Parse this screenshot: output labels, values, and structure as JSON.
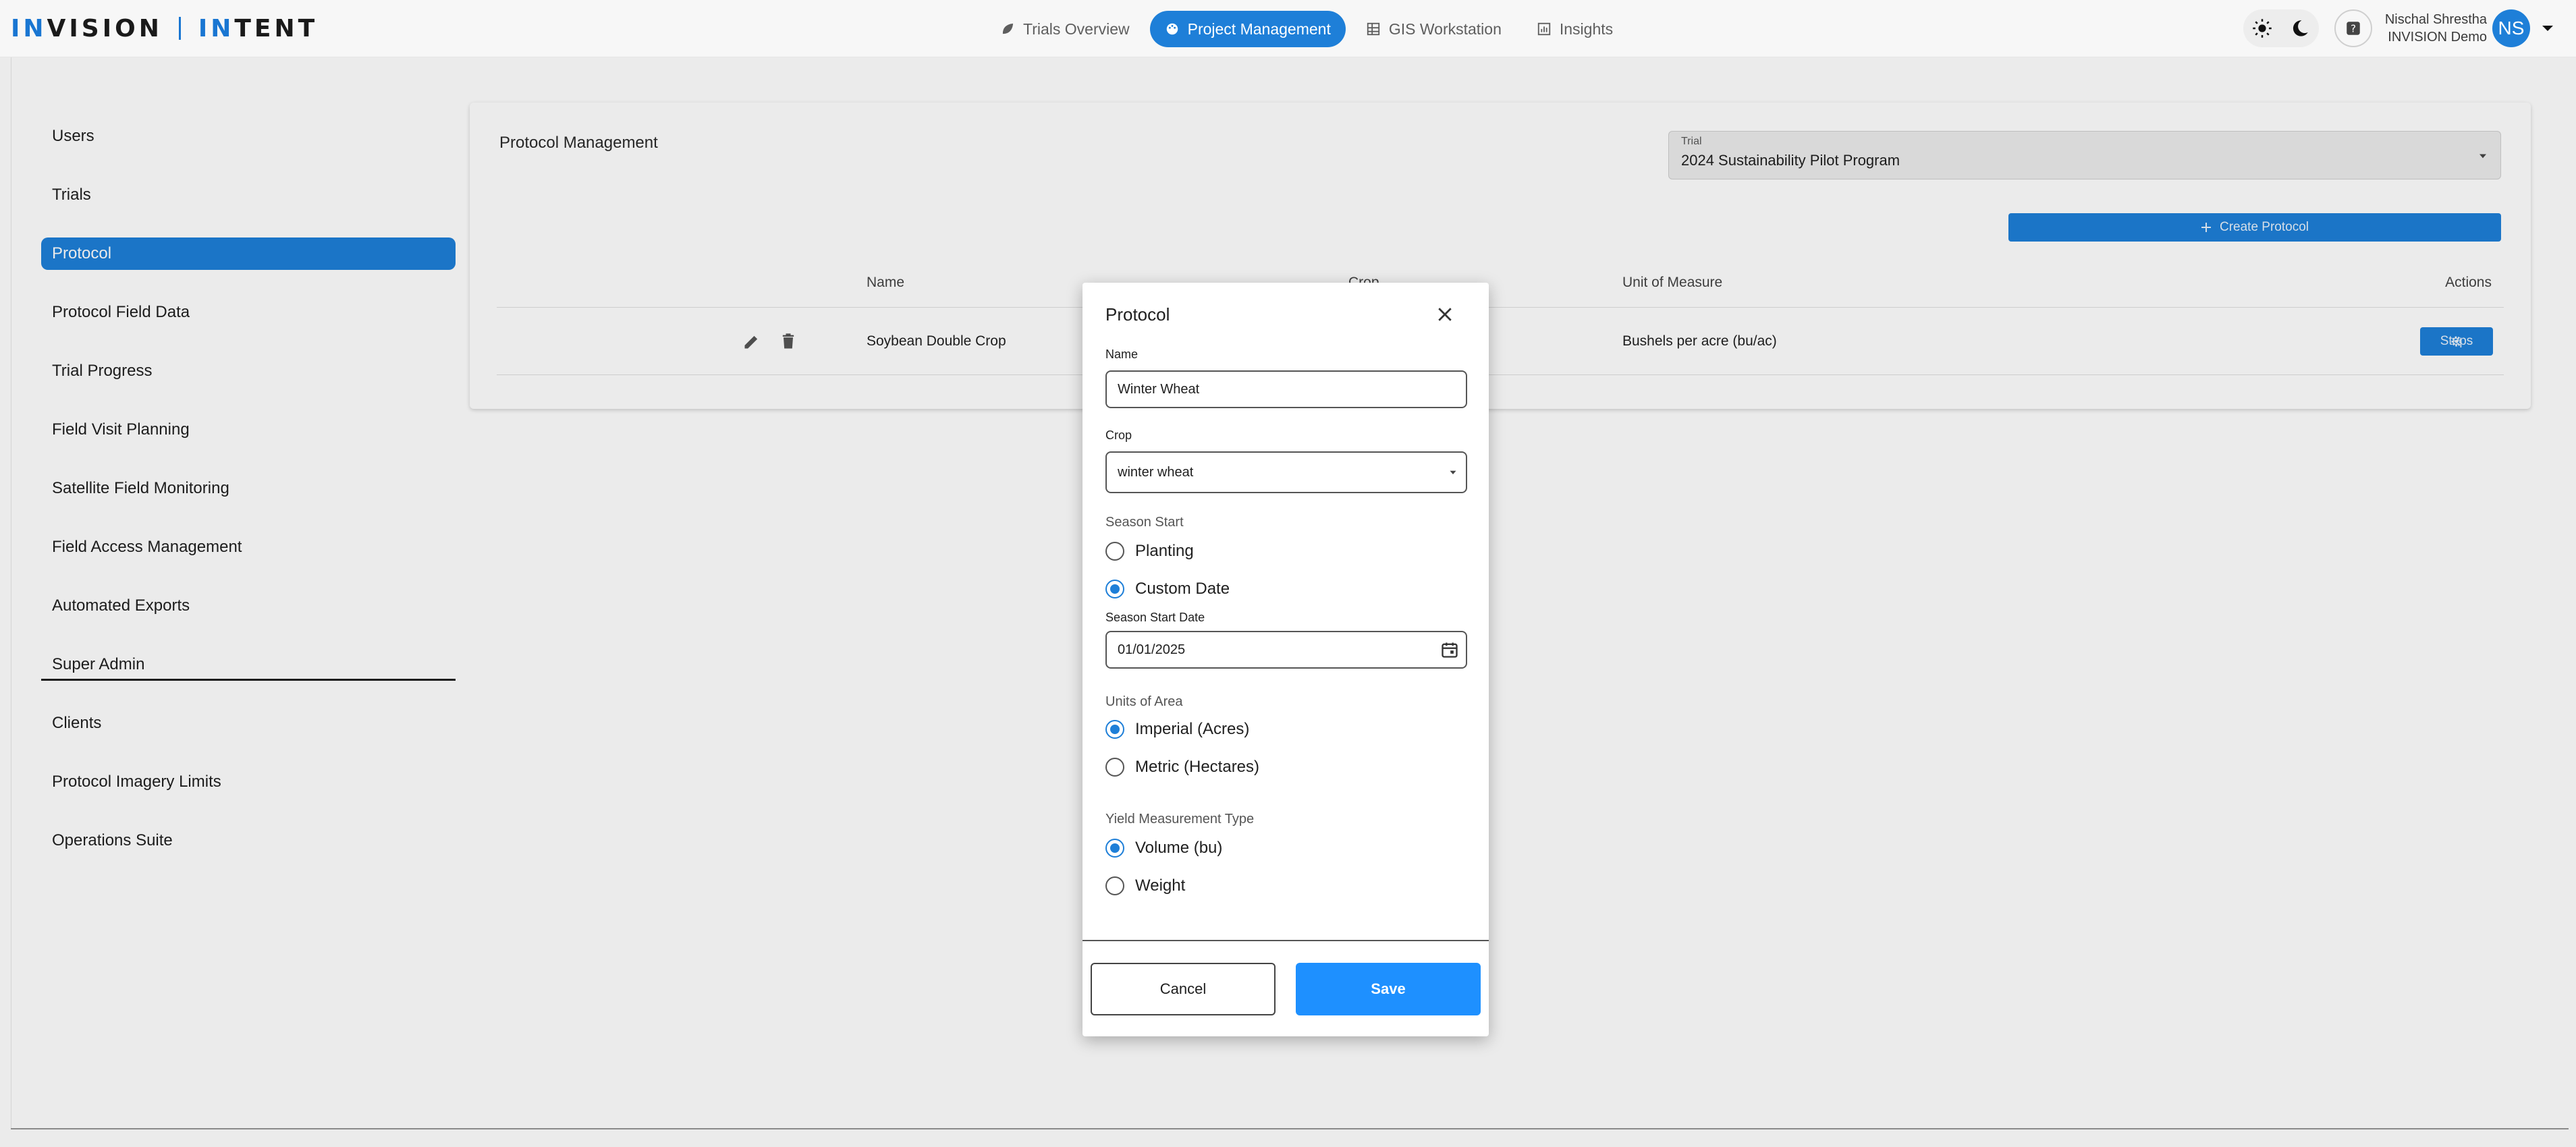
{
  "brand": {
    "word1_a": "IN",
    "word1_b": "VISION",
    "word2_a": "IN",
    "word2_b": "TENT"
  },
  "nav": [
    {
      "label": "Trials Overview",
      "icon": "leaf-icon"
    },
    {
      "label": "Project Management",
      "icon": "palette-icon",
      "active": true
    },
    {
      "label": "GIS Workstation",
      "icon": "grid-icon"
    },
    {
      "label": "Insights",
      "icon": "chart-icon"
    }
  ],
  "user": {
    "name": "Nischal Shrestha",
    "org": "INVISION Demo",
    "initials": "NS"
  },
  "sidebar": {
    "items": [
      {
        "label": "Users"
      },
      {
        "label": "Trials"
      },
      {
        "label": "Protocol",
        "active": true
      },
      {
        "label": "Protocol Field Data"
      },
      {
        "label": "Trial Progress"
      },
      {
        "label": "Field Visit Planning"
      },
      {
        "label": "Satellite Field Monitoring"
      },
      {
        "label": "Field Access Management"
      },
      {
        "label": "Automated Exports"
      }
    ],
    "section": "Super Admin",
    "admin_items": [
      {
        "label": "Clients"
      },
      {
        "label": "Protocol Imagery Limits"
      },
      {
        "label": "Operations Suite"
      }
    ]
  },
  "main": {
    "title": "Protocol Management",
    "trial_label": "Trial",
    "trial_value": "2024 Sustainability Pilot Program",
    "create_label": "Create Protocol",
    "columns": {
      "name": "Name",
      "crop": "Crop",
      "unit": "Unit of Measure",
      "actions": "Actions"
    },
    "rows": [
      {
        "name": "Soybean Double Crop",
        "unit": "Bushels per acre (bu/ac)",
        "action": "Steps"
      }
    ]
  },
  "modal": {
    "title": "Protocol",
    "name_label": "Name",
    "name_value": "Winter Wheat",
    "crop_label": "Crop",
    "crop_value": "winter wheat",
    "season_start_label": "Season Start",
    "season_options": [
      "Planting",
      "Custom Date"
    ],
    "season_selected": "Custom Date",
    "season_date_label": "Season Start Date",
    "season_date_value": "01/01/2025",
    "area_label": "Units of Area",
    "area_options": [
      "Imperial (Acres)",
      "Metric (Hectares)"
    ],
    "area_selected": "Imperial (Acres)",
    "yield_label": "Yield Measurement Type",
    "yield_options": [
      "Volume (bu)",
      "Weight"
    ],
    "yield_selected": "Volume (bu)",
    "cancel_label": "Cancel",
    "save_label": "Save"
  },
  "colors": {
    "accent": "#1e7fd8",
    "save": "#1e90ff",
    "text": "#1f1f1f"
  }
}
